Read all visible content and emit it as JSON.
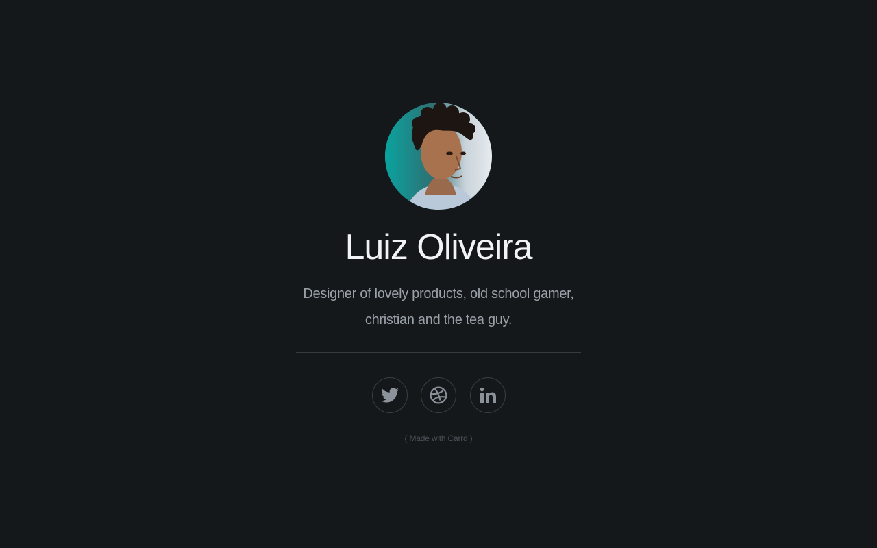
{
  "profile": {
    "name": "Luiz Oliveira",
    "bio_line1": "Designer of lovely products, old school gamer,",
    "bio_line2": "christian and the tea guy.",
    "avatar_icon": "portrait-photo"
  },
  "social_links": [
    {
      "name": "twitter",
      "icon": "twitter-icon"
    },
    {
      "name": "dribbble",
      "icon": "dribbble-icon"
    },
    {
      "name": "linkedin",
      "icon": "linkedin-icon"
    }
  ],
  "footer": {
    "open": "( ",
    "prefix": "Made with ",
    "link": "Carrd",
    "close": " )"
  },
  "colors": {
    "background": "#15181b",
    "name": "#f2f3f4",
    "bio": "#9aa1a8",
    "icon": "#8c9299",
    "border": "#3a3f45",
    "avatar_bg": "#0e9a9c"
  }
}
